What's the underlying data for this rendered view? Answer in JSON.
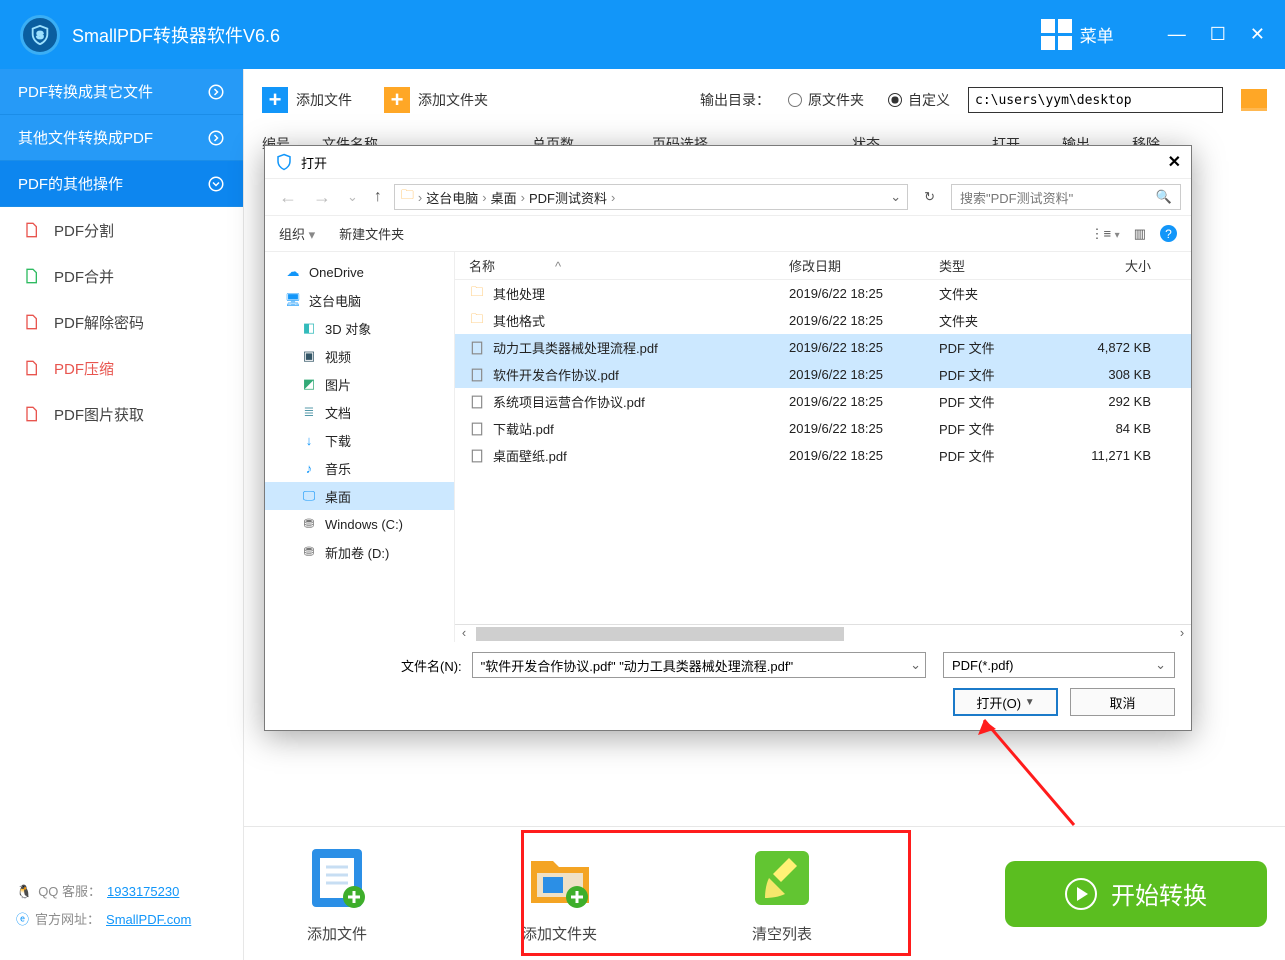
{
  "titlebar": {
    "title": "SmallPDF转换器软件V6.6",
    "menu": "菜单"
  },
  "sidebar": {
    "cats": [
      {
        "label": "PDF转换成其它文件"
      },
      {
        "label": "其他文件转换成PDF"
      },
      {
        "label": "PDF的其他操作"
      }
    ],
    "subs": [
      {
        "label": "PDF分割"
      },
      {
        "label": "PDF合并"
      },
      {
        "label": "PDF解除密码"
      },
      {
        "label": "PDF压缩"
      },
      {
        "label": "PDF图片获取"
      }
    ],
    "qq_label": "QQ 客服：",
    "qq_value": "1933175230",
    "site_label": "官方网址：",
    "site_value": "SmallPDF.com"
  },
  "toolbar": {
    "add_file": "添加文件",
    "add_folder": "添加文件夹",
    "output_label": "输出目录：",
    "radio_origin": "原文件夹",
    "radio_custom": "自定义",
    "path_value": "c:\\users\\yym\\desktop"
  },
  "columns": {
    "c1": "编号",
    "c2": "文件名称",
    "c3": "总页数",
    "c4": "页码选择",
    "c5": "状态",
    "c6": "打开",
    "c7": "输出",
    "c8": "移除"
  },
  "bottom": {
    "add_file": "添加文件",
    "add_folder": "添加文件夹",
    "clear_list": "清空列表",
    "start": "开始转换"
  },
  "dialog": {
    "title": "打开",
    "crumbs": [
      "这台电脑",
      "桌面",
      "PDF测试资料"
    ],
    "search_placeholder": "搜索\"PDF测试资料\"",
    "organize": "组织",
    "new_folder": "新建文件夹",
    "view_icon": "⋮≡",
    "layout_icon": "▥",
    "tree": [
      {
        "label": "OneDrive",
        "icon": "cloud"
      },
      {
        "label": "这台电脑",
        "icon": "pc"
      },
      {
        "label": "3D 对象",
        "icon": "3d",
        "child": true
      },
      {
        "label": "视频",
        "icon": "video",
        "child": true
      },
      {
        "label": "图片",
        "icon": "pic",
        "child": true
      },
      {
        "label": "文档",
        "icon": "doc",
        "child": true
      },
      {
        "label": "下载",
        "icon": "down",
        "child": true
      },
      {
        "label": "音乐",
        "icon": "music",
        "child": true
      },
      {
        "label": "桌面",
        "icon": "desk",
        "child": true,
        "sel": true
      },
      {
        "label": "Windows (C:)",
        "icon": "disk",
        "child": true
      },
      {
        "label": "新加卷 (D:)",
        "icon": "disk",
        "child": true
      }
    ],
    "cols": {
      "name": "名称",
      "date": "修改日期",
      "type": "类型",
      "size": "大小"
    },
    "files": [
      {
        "name": "其他处理",
        "date": "2019/6/22 18:25",
        "type": "文件夹",
        "size": "",
        "kind": "folder"
      },
      {
        "name": "其他格式",
        "date": "2019/6/22 18:25",
        "type": "文件夹",
        "size": "",
        "kind": "folder"
      },
      {
        "name": "动力工具类器械处理流程.pdf",
        "date": "2019/6/22 18:25",
        "type": "PDF 文件",
        "size": "4,872 KB",
        "kind": "pdf",
        "sel": true
      },
      {
        "name": "软件开发合作协议.pdf",
        "date": "2019/6/22 18:25",
        "type": "PDF 文件",
        "size": "308 KB",
        "kind": "pdf",
        "sel": true
      },
      {
        "name": "系统项目运营合作协议.pdf",
        "date": "2019/6/22 18:25",
        "type": "PDF 文件",
        "size": "292 KB",
        "kind": "pdf"
      },
      {
        "name": "下载站.pdf",
        "date": "2019/6/22 18:25",
        "type": "PDF 文件",
        "size": "84 KB",
        "kind": "pdf"
      },
      {
        "name": "桌面壁纸.pdf",
        "date": "2019/6/22 18:25",
        "type": "PDF 文件",
        "size": "11,271 KB",
        "kind": "pdf"
      }
    ],
    "fname_label": "文件名(N):",
    "fname_value": "\"软件开发合作协议.pdf\" \"动力工具类器械处理流程.pdf\"",
    "ftype_value": "PDF(*.pdf)",
    "open_btn": "打开(O)",
    "cancel_btn": "取消"
  }
}
